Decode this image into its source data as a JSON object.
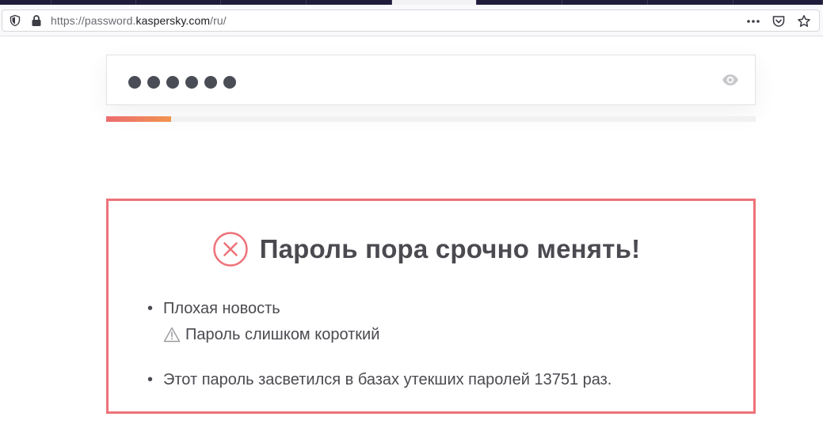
{
  "browser": {
    "url_prefix": "https://password.",
    "url_host": "kaspersky.com",
    "url_suffix": "/ru/",
    "icons": [
      "shield-icon",
      "lock-icon",
      "more-icon",
      "pocket-icon",
      "star-icon"
    ]
  },
  "password_field": {
    "masked_length": 6,
    "strength_fill": 0.1
  },
  "result": {
    "title": "Пароль пора срочно менять!",
    "bullet1": "Плохая новость",
    "warning": "Пароль слишком короткий",
    "bullet2": "Этот пароль засветился в базах утекших паролей 13751 раз.",
    "accent_color": "#ee7279"
  }
}
